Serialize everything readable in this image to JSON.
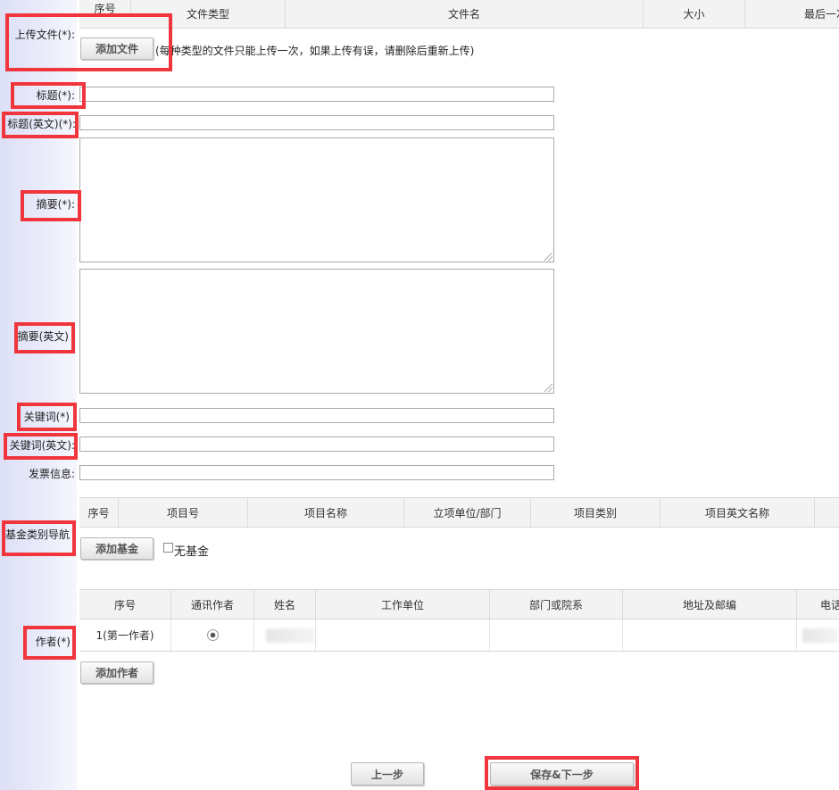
{
  "upload": {
    "label": "上传文件(*):",
    "columns": [
      "序号",
      "文件类型",
      "文件名",
      "大小",
      "最后一次"
    ],
    "add_button": "添加文件",
    "hint": "(每种类型的文件只能上传一次，如果上传有误，请删除后重新上传)"
  },
  "fields": {
    "title_label": "标题(*):",
    "title_value": "",
    "title_en_label": "标题(英文)(*):",
    "title_en_value": "",
    "abstract_label": "摘要(*):",
    "abstract_value": "",
    "abstract_en_label": "摘要(英文)",
    "abstract_en_value": "",
    "keywords_label": "关键词(*)",
    "keywords_value": "",
    "keywords_en_label": "关键词(英文):",
    "keywords_en_value": "",
    "invoice_label": "发票信息:",
    "invoice_value": ""
  },
  "fund": {
    "label": "基金类别导航",
    "columns": [
      "序号",
      "项目号",
      "项目名称",
      "立项单位/部门",
      "项目类别",
      "项目英文名称"
    ],
    "add_button": "添加基金",
    "no_fund_label": "无基金",
    "no_fund_checked": false
  },
  "authors": {
    "label": "作者(*)",
    "columns": [
      "序号",
      "通讯作者",
      "姓名",
      "工作单位",
      "部门或院系",
      "地址及邮编",
      "电话"
    ],
    "rows": [
      {
        "index": "1(第一作者)",
        "corresponding": true,
        "name": "",
        "org": "",
        "dept": "",
        "address": "",
        "phone": ""
      }
    ],
    "add_button": "添加作者"
  },
  "nav": {
    "prev_button": "上一步",
    "next_button": "保存&下一步"
  },
  "colors": {
    "annotation_red": "#f0363c",
    "sidebar": "#dde0f6",
    "header_bg": "#f3f3f3"
  }
}
